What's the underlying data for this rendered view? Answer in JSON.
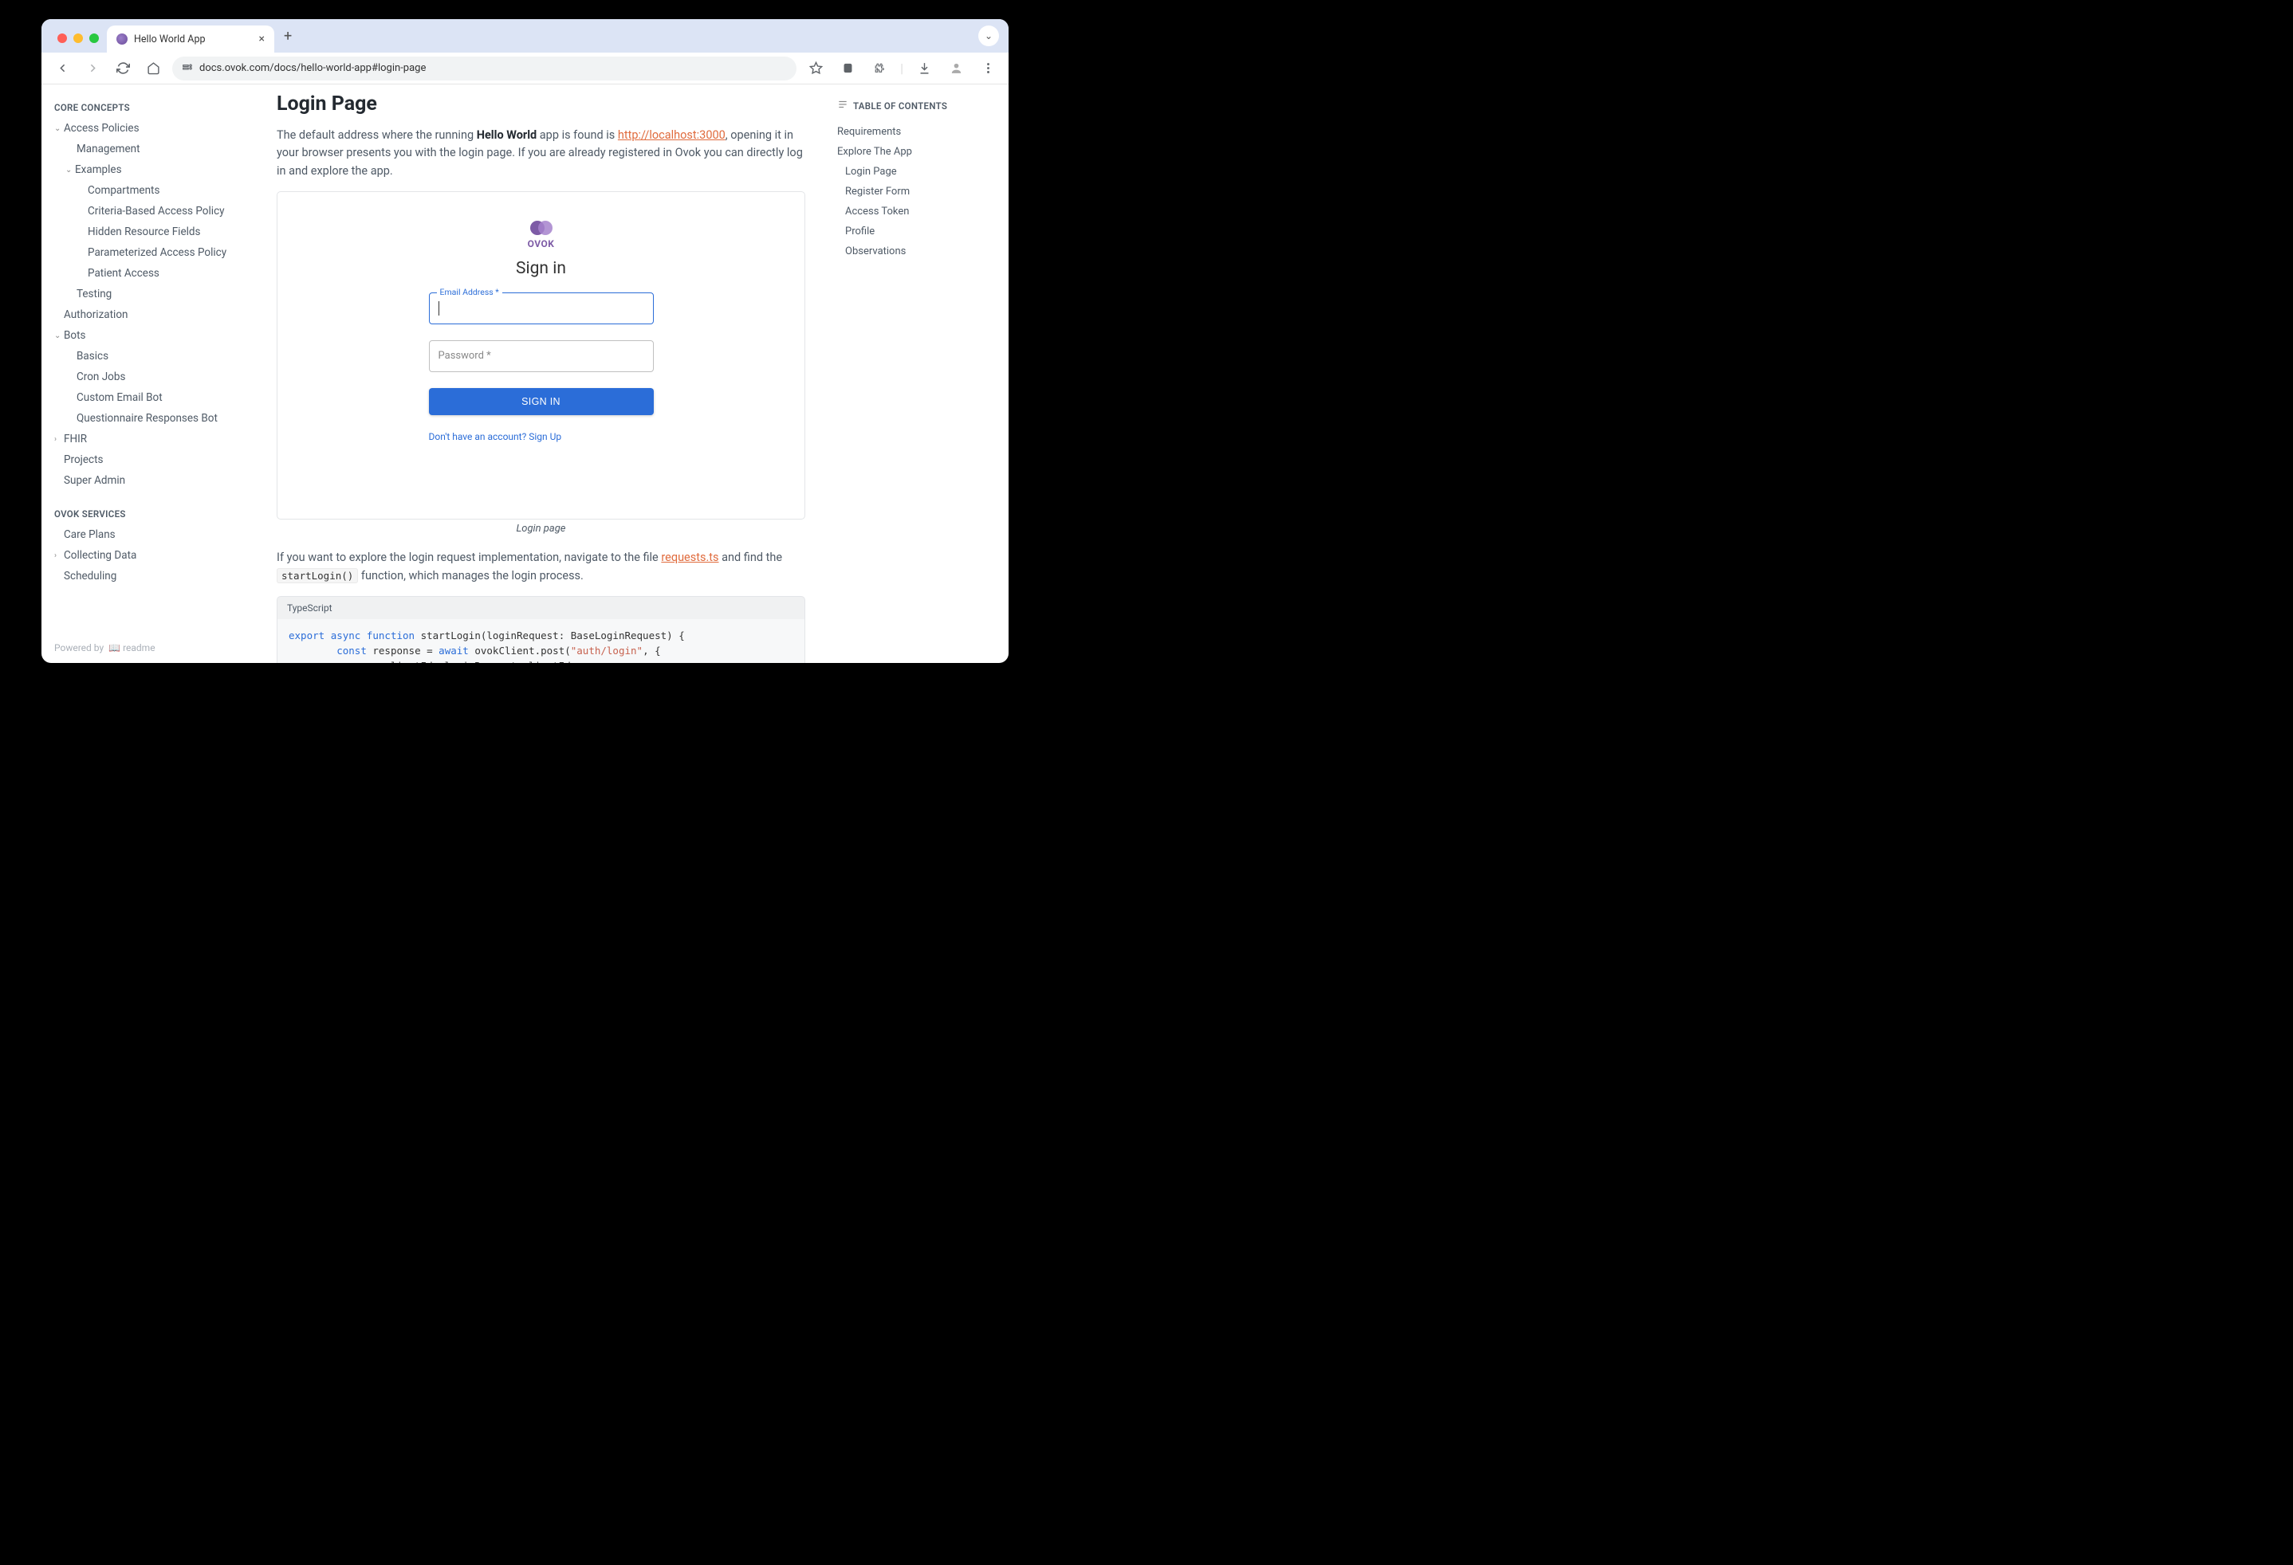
{
  "browser": {
    "tab_title": "Hello World App",
    "url": "docs.ovok.com/docs/hello-world-app#login-page"
  },
  "sidebar": {
    "section1_title": "CORE CONCEPTS",
    "items": [
      {
        "label": "Access Policies",
        "caret": "down",
        "indent": 0
      },
      {
        "label": "Management",
        "caret": "",
        "indent": 2
      },
      {
        "label": "Examples",
        "caret": "down",
        "indent": 1
      },
      {
        "label": "Compartments",
        "caret": "",
        "indent": 3
      },
      {
        "label": "Criteria-Based Access Policy",
        "caret": "",
        "indent": 3
      },
      {
        "label": "Hidden Resource Fields",
        "caret": "",
        "indent": 3
      },
      {
        "label": "Parameterized Access Policy",
        "caret": "",
        "indent": 3
      },
      {
        "label": "Patient Access",
        "caret": "",
        "indent": 3
      },
      {
        "label": "Testing",
        "caret": "",
        "indent": 2
      },
      {
        "label": "Authorization",
        "caret": "",
        "indent": 0
      },
      {
        "label": "Bots",
        "caret": "down",
        "indent": 0
      },
      {
        "label": "Basics",
        "caret": "",
        "indent": 2
      },
      {
        "label": "Cron Jobs",
        "caret": "",
        "indent": 2
      },
      {
        "label": "Custom Email Bot",
        "caret": "",
        "indent": 2
      },
      {
        "label": "Questionnaire Responses Bot",
        "caret": "",
        "indent": 2
      },
      {
        "label": "FHIR",
        "caret": "right",
        "indent": 0
      },
      {
        "label": "Projects",
        "caret": "",
        "indent": 0
      },
      {
        "label": "Super Admin",
        "caret": "",
        "indent": 0
      }
    ],
    "section2_title": "OVOK SERVICES",
    "items2": [
      {
        "label": "Care Plans",
        "caret": "",
        "indent": 0
      },
      {
        "label": "Collecting Data",
        "caret": "right",
        "indent": 0
      },
      {
        "label": "Scheduling",
        "caret": "",
        "indent": 0
      }
    ],
    "powered_by": "Powered by",
    "readme": "readme"
  },
  "main": {
    "heading": "Login Page",
    "para1_pre": "The default address where the running ",
    "para1_bold": "Hello World",
    "para1_mid": " app is found is ",
    "para1_link": "http://localhost:3000",
    "para1_post": ", opening it in your browser presents you with the login page. If you are already registered in Ovok you can directly log in and explore the app.",
    "figure": {
      "brand": "OVOK",
      "title": "Sign in",
      "email_label": "Email Address *",
      "password_placeholder": "Password *",
      "button": "SIGN IN",
      "signup": "Don't have an account? Sign Up"
    },
    "caption": "Login page",
    "para2_pre": "If you want to explore the login request implementation, navigate to the file ",
    "para2_link": "requests.ts",
    "para2_mid": " and find the ",
    "para2_code": "startLogin()",
    "para2_post": " function, which manages the login process.",
    "code_lang": "TypeScript",
    "code": {
      "l1_kw1": "export",
      "l1_kw2": "async",
      "l1_kw3": "function",
      "l1_rest": " startLogin(loginRequest: BaseLoginRequest) {",
      "l2_kw1": "const",
      "l2_mid": " response = ",
      "l2_kw2": "await",
      "l2_rest1": " ovokClient.post(",
      "l2_str": "\"auth/login\"",
      "l2_rest2": ", {",
      "l3_rest": "clientId: loginRequest.clientId,"
    }
  },
  "toc": {
    "header": "TABLE OF CONTENTS",
    "items": [
      {
        "label": "Requirements",
        "indent": false
      },
      {
        "label": "Explore The App",
        "indent": false
      },
      {
        "label": "Login Page",
        "indent": true
      },
      {
        "label": "Register Form",
        "indent": true
      },
      {
        "label": "Access Token",
        "indent": true
      },
      {
        "label": "Profile",
        "indent": true
      },
      {
        "label": "Observations",
        "indent": true
      }
    ]
  }
}
